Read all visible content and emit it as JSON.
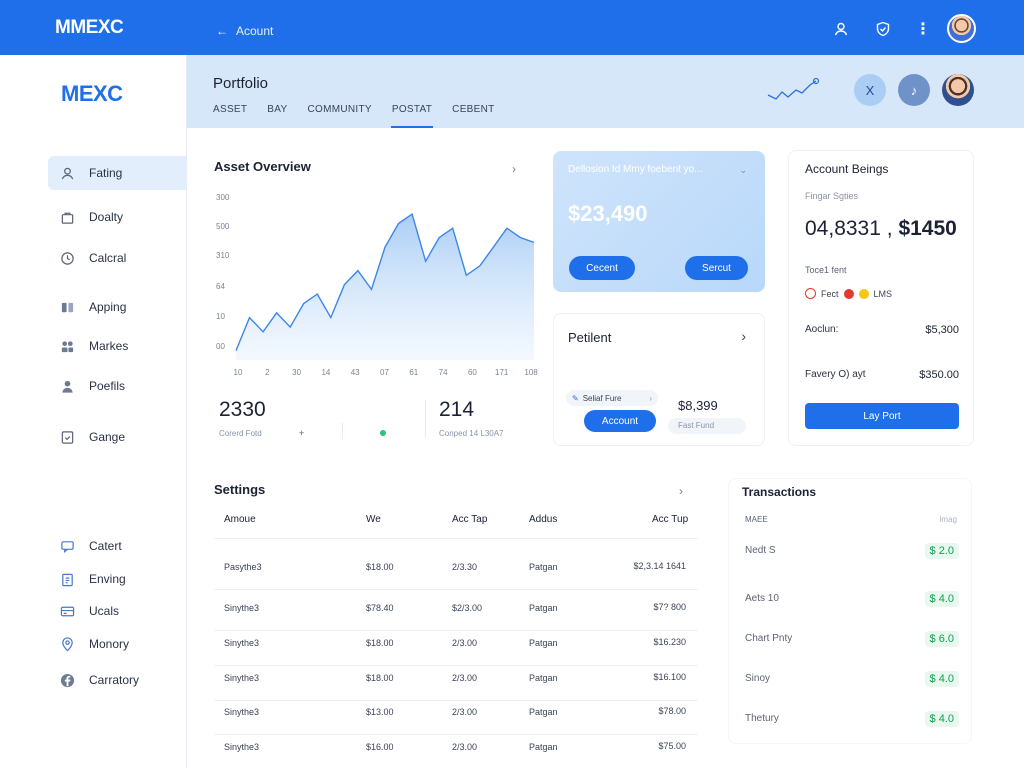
{
  "topbar": {
    "logo": "MMEXC",
    "back_label": "Acount",
    "icons": [
      "user-icon",
      "shield-icon",
      "more-icon"
    ]
  },
  "sidebar": {
    "logo": "MEXC",
    "items": [
      {
        "label": "Fating",
        "icon": "user-icon",
        "active": true
      },
      {
        "label": "Doalty",
        "icon": "bag-icon"
      },
      {
        "label": "Calcral",
        "icon": "clock-icon"
      },
      {
        "label": "Apping",
        "icon": "book-icon"
      },
      {
        "label": "Markes",
        "icon": "grid-icon"
      },
      {
        "label": "Poefils",
        "icon": "person-icon"
      },
      {
        "label": "Gange",
        "icon": "doc-icon"
      },
      {
        "label": "Catert",
        "icon": "chat-icon"
      },
      {
        "label": "Enving",
        "icon": "clipboard-icon"
      },
      {
        "label": "Ucals",
        "icon": "card-icon"
      },
      {
        "label": "Monory",
        "icon": "pin-icon"
      },
      {
        "label": "Carratory",
        "icon": "facebook-icon"
      }
    ]
  },
  "header": {
    "title": "Portfolio",
    "tabs": [
      "ASSET",
      "BAY",
      "COMMUNITY",
      "POSTAT",
      "CEBENT"
    ],
    "active_tab": 3,
    "btn_x": "X",
    "btn_note": "♪"
  },
  "overview": {
    "title": "Asset Overview",
    "stat1_value": "2330",
    "stat1_label": "Corerd Fotd",
    "stat1_plus": "+",
    "stat2_value": "214",
    "stat2_label": "Conped 14 L30A7"
  },
  "chart_data": {
    "type": "area",
    "yticks": [
      "300",
      "500",
      "310",
      "64",
      "10",
      "00"
    ],
    "xticks": [
      "10",
      "2",
      "30",
      "14",
      "43",
      "07",
      "61",
      "74",
      "60",
      "171",
      "108"
    ],
    "values": [
      2,
      9,
      6,
      10,
      7,
      12,
      14,
      9,
      16,
      19,
      15,
      24,
      29,
      31,
      21,
      26,
      28,
      18,
      20,
      24,
      28,
      26,
      25
    ]
  },
  "balance": {
    "subtitle": "Dellosion Id Mmy foebent yo...",
    "amount": "$23,490",
    "btn1": "Cecent",
    "btn2": "Sercut"
  },
  "petitent": {
    "title": "Petilent",
    "select_label": "Seliaf Fure",
    "account_btn": "Account",
    "value": "$8,399",
    "value_label": "Fast Fund"
  },
  "account": {
    "title": "Account Beings",
    "subtitle": "Fingar Sgties",
    "big_left": "04,8331 ,",
    "big_right": "$1450",
    "total_label": "Toce1 fent",
    "legend_a": "Fect",
    "legend_b": "LMS",
    "row1_label": "Aoclun:",
    "row1_value": "$5,300",
    "row2_label": "Favery O) ayt",
    "row2_value": "$350.00",
    "button": "Lay Port",
    "colors": {
      "red": "#e03b2f",
      "yellow": "#f5c518",
      "accent": "#1f6fea"
    }
  },
  "settings": {
    "title": "Settings",
    "columns": [
      "Amoue",
      "We",
      "Acc Tap",
      "Addus",
      "Acc Tup"
    ],
    "rows": [
      [
        "Pasythe3",
        "$18.00",
        "2/3.30",
        "Patgan",
        "$2,3.14 1641"
      ],
      [
        "Sinythe3",
        "$78.40",
        "$2/3.00",
        "Patgan",
        "$7? 800"
      ],
      [
        "Sinythe3",
        "$18.00",
        "2/3.00",
        "Patgan",
        "$16.230"
      ],
      [
        "Sinythe3",
        "$18.00",
        "2/3.00",
        "Patgan",
        "$16.100"
      ],
      [
        "Sinythe3",
        "$13.00",
        "2/3.00",
        "Patgan",
        "$78.00"
      ],
      [
        "Sinythe3",
        "$16.00",
        "2/3.00",
        "Patgan",
        "$75.00"
      ]
    ]
  },
  "transactions": {
    "title": "Transactions",
    "col_left": "MAEE",
    "col_right": "Imag",
    "items": [
      {
        "name": "Nedt S",
        "amount": "$ 2.0"
      },
      {
        "name": "Aets 10",
        "amount": "$ 4.0"
      },
      {
        "name": "Chart Pnty",
        "amount": "$ 6.0"
      },
      {
        "name": "Sinoy",
        "amount": "$ 4.0"
      },
      {
        "name": "Thetury",
        "amount": "$ 4.0"
      }
    ]
  }
}
